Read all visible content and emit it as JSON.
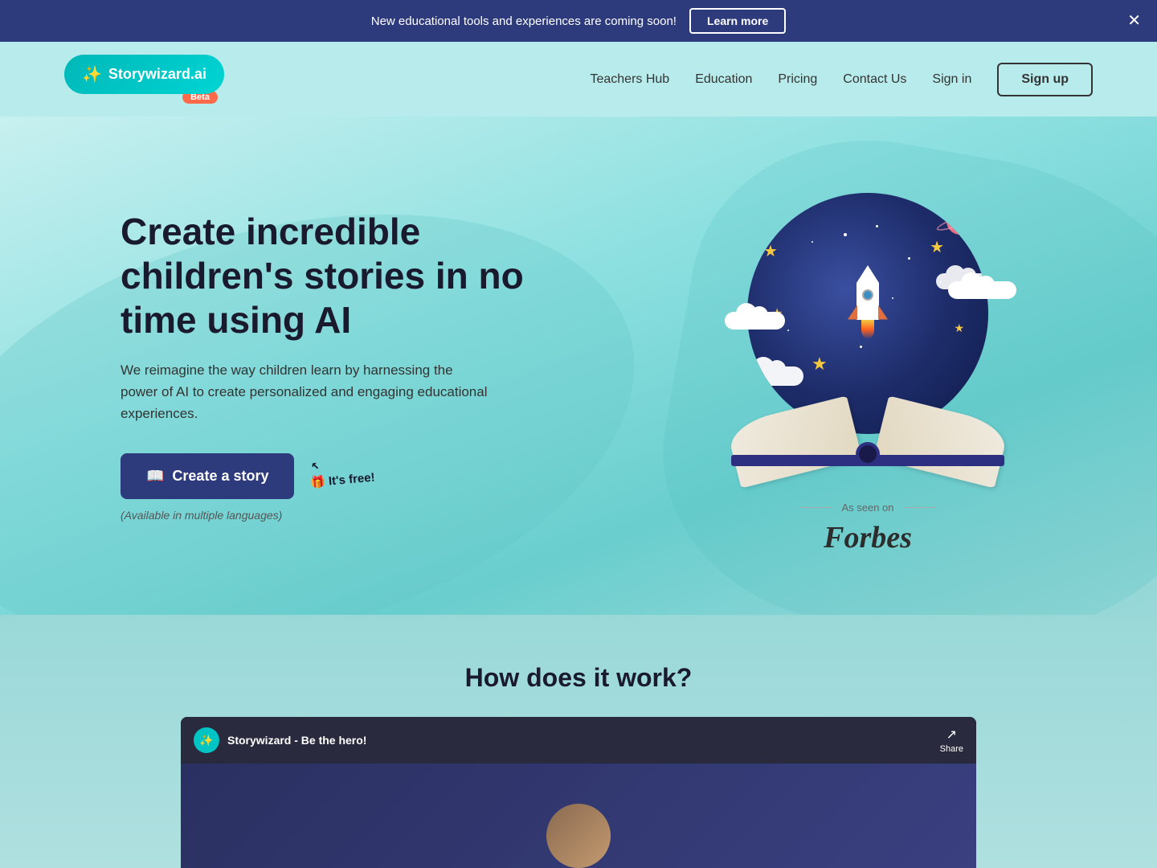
{
  "announcement": {
    "text": "New educational tools and experiences are coming soon!",
    "learn_more_label": "Learn more"
  },
  "nav": {
    "logo_text": "Storywizard.ai",
    "beta_label": "Beta",
    "links": [
      {
        "id": "teachers-hub",
        "label": "Teachers Hub"
      },
      {
        "id": "education",
        "label": "Education"
      },
      {
        "id": "pricing",
        "label": "Pricing"
      },
      {
        "id": "contact-us",
        "label": "Contact Us"
      },
      {
        "id": "sign-in",
        "label": "Sign in"
      }
    ],
    "signup_label": "Sign up"
  },
  "hero": {
    "title": "Create incredible children's stories in no time using AI",
    "subtitle": "We reimagine the way children learn by harnessing the power of AI to create personalized and engaging educational experiences.",
    "cta_label": "Create a story",
    "available_text": "(Available in multiple languages)",
    "its_free": "It's free!",
    "arrow_hint": "↖"
  },
  "forbes": {
    "as_seen_on": "As seen on",
    "name": "Forbes"
  },
  "how_section": {
    "title": "How does it work?",
    "video_channel": "Storywizard - Be the hero!",
    "share_label": "Share"
  },
  "icons": {
    "book_emoji": "📖",
    "wizard_emoji": "✨",
    "close_symbol": "✕",
    "share_symbol": "↗"
  }
}
